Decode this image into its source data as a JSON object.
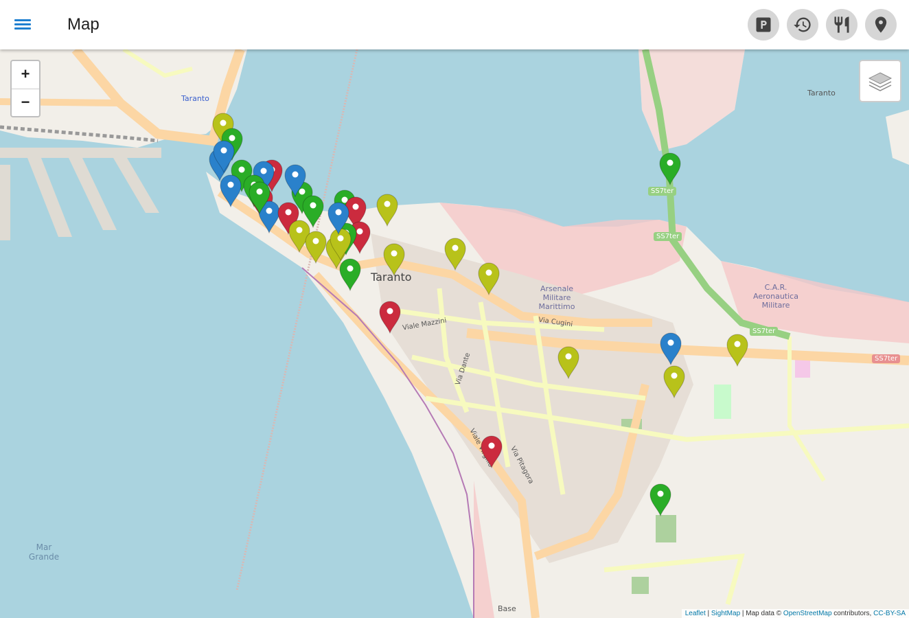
{
  "app_bar": {
    "title": "Map",
    "actions": [
      {
        "name": "parking-icon"
      },
      {
        "name": "history-icon"
      },
      {
        "name": "restaurant-icon"
      },
      {
        "name": "location-pin-icon"
      }
    ]
  },
  "map": {
    "zoom_in_label": "+",
    "zoom_out_label": "−",
    "place_labels": {
      "city": "Taranto",
      "taranto_top": "Taranto",
      "taranto_right": "Taranto",
      "arsenale": "Arsenale Militare Marittimo",
      "car": "C.A.R. Aeronautica Militare",
      "mar_grande": "Mar Grande",
      "base_navale": "Base",
      "road_ss7ter_1": "SS7ter",
      "road_ss7ter_2": "SS7ter",
      "road_ss7ter_3": "SS7ter",
      "road_ss7ter_4": "SS7ter",
      "via_cugini": "Via Cugini",
      "viale_mazzini": "Viale Mazzini",
      "via_dante": "Via Dante",
      "via_pitagora": "Via Pitagora",
      "via_virgilio": "Viale Virgilio"
    },
    "attribution": {
      "leaflet": "Leaflet",
      "sep1": " | ",
      "sightmap": "SightMap",
      "text": " | Map data © ",
      "osm": "OpenStreetMap",
      "contrib": " contributors, ",
      "license": "CC-BY-SA"
    },
    "marker_colors": {
      "blue": "#2a81cb",
      "green": "#2aad27",
      "red": "#cb2b3e",
      "yellow": "#b8c21a"
    },
    "markers": [
      {
        "color": "yellow"
      },
      {
        "color": "green"
      },
      {
        "color": "blue"
      },
      {
        "color": "blue"
      },
      {
        "color": "green"
      },
      {
        "color": "blue"
      },
      {
        "color": "red"
      },
      {
        "color": "blue"
      },
      {
        "color": "green"
      },
      {
        "color": "red"
      },
      {
        "color": "blue"
      },
      {
        "color": "green"
      },
      {
        "color": "green"
      },
      {
        "color": "red"
      },
      {
        "color": "green"
      },
      {
        "color": "blue"
      },
      {
        "color": "green"
      },
      {
        "color": "red"
      },
      {
        "color": "red"
      },
      {
        "color": "yellow"
      },
      {
        "color": "yellow"
      },
      {
        "color": "yellow"
      },
      {
        "color": "yellow"
      },
      {
        "color": "green"
      },
      {
        "color": "yellow"
      },
      {
        "color": "yellow"
      },
      {
        "color": "yellow"
      },
      {
        "color": "yellow"
      },
      {
        "color": "red"
      },
      {
        "color": "red"
      },
      {
        "color": "green"
      },
      {
        "color": "blue"
      },
      {
        "color": "green"
      },
      {
        "color": "blue"
      },
      {
        "color": "yellow"
      },
      {
        "color": "yellow"
      },
      {
        "color": "yellow"
      },
      {
        "color": "green"
      }
    ]
  }
}
